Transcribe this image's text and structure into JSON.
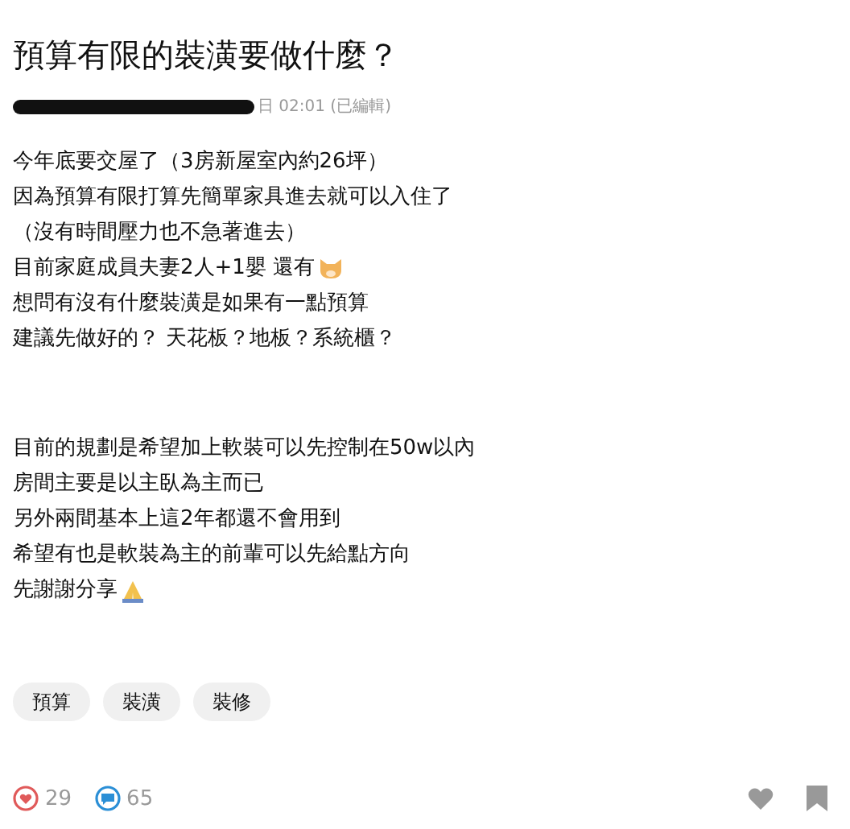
{
  "post": {
    "title": "預算有限的裝潢要做什麼？",
    "meta": "日 02:01 (已編輯)",
    "paragraphs": [
      [
        {
          "kind": "plain",
          "text": "今年底要交屋了（3房新屋室內約26坪）"
        },
        {
          "kind": "plain",
          "text": "因為預算有限打算先簡單家具進去就可以入住了"
        },
        {
          "kind": "plain",
          "text": "（沒有時間壓力也不急著進去）"
        },
        {
          "kind": "with-icon",
          "text": "目前家庭成員夫妻2人+1嬰 還有"
        },
        {
          "kind": "plain",
          "text": "想問有沒有什麼裝潢是如果有一點預算"
        },
        {
          "kind": "plain",
          "text": "建議先做好的？ 天花板？地板？系統櫃？"
        }
      ],
      [
        {
          "kind": "plain",
          "text": "目前的規劃是希望加上軟裝可以先控制在50w以內"
        },
        {
          "kind": "plain",
          "text": "房間主要是以主臥為主而已"
        },
        {
          "kind": "plain",
          "text": "另外兩間基本上這2年都還不會用到"
        },
        {
          "kind": "plain",
          "text": "希望有也是軟裝為主的前輩可以先給點方向"
        },
        {
          "kind": "with-icon",
          "text": "先謝謝分享"
        }
      ]
    ],
    "tags": [
      "預算",
      "裝潢",
      "裝修"
    ],
    "likes": "29",
    "comments": "65"
  }
}
